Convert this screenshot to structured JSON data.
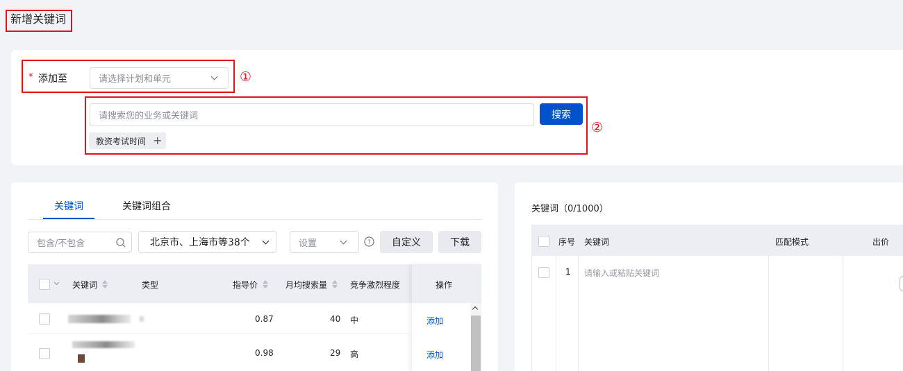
{
  "page_title": "新增关键词",
  "form": {
    "required_mark": "*",
    "add_to_label": "添加至",
    "add_to_placeholder": "请选择计划和单元",
    "search_placeholder": "请搜索您的业务或关键词",
    "search_button": "搜索",
    "suggest_tag": "教资考试时间",
    "marker_1": "①",
    "marker_2": "②"
  },
  "left_panel": {
    "tabs": [
      {
        "label": "关键词",
        "active": true
      },
      {
        "label": "关键词组合",
        "active": false
      }
    ],
    "filter_placeholder": "包含/不包含",
    "region_select": "北京市、上海市等38个",
    "settings_placeholder": "设置",
    "customize_button": "自定义",
    "download_button": "下载",
    "columns": [
      "关键词",
      "类型",
      "指导价",
      "月均搜索量",
      "竞争激烈程度",
      "操作"
    ],
    "rows": [
      {
        "price": "0.87",
        "searches": "40",
        "competition": "中",
        "action": "添加"
      },
      {
        "price": "0.98",
        "searches": "29",
        "competition": "高",
        "action": "添加"
      }
    ]
  },
  "right_panel": {
    "title": "关键词（0/1000）",
    "columns": [
      "序号",
      "关键词",
      "匹配模式",
      "出价"
    ],
    "rows": [
      {
        "index": "1",
        "keyword_placeholder": "请输入或粘贴关键词"
      }
    ]
  },
  "colors": {
    "accent": "#0052cc",
    "annotation_red": "#e0141e"
  }
}
